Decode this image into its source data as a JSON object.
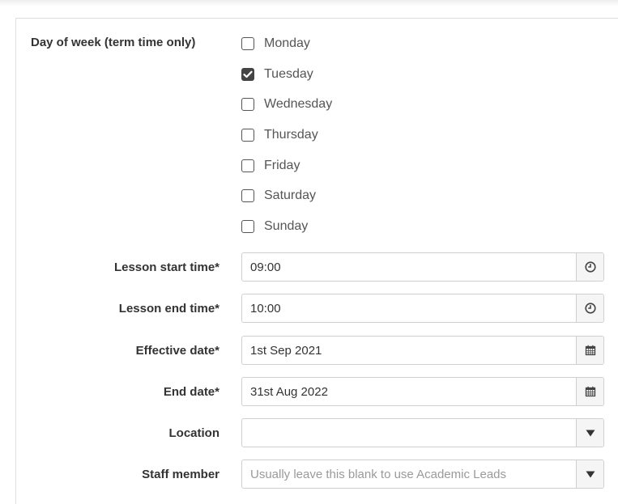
{
  "form": {
    "day_of_week": {
      "label": "Day of week (term time only)",
      "options": [
        {
          "label": "Monday",
          "checked": false
        },
        {
          "label": "Tuesday",
          "checked": true
        },
        {
          "label": "Wednesday",
          "checked": false
        },
        {
          "label": "Thursday",
          "checked": false
        },
        {
          "label": "Friday",
          "checked": false
        },
        {
          "label": "Saturday",
          "checked": false
        },
        {
          "label": "Sunday",
          "checked": false
        }
      ]
    },
    "lesson_start_time": {
      "label": "Lesson start time*",
      "value": "09:00",
      "icon": "clock-icon"
    },
    "lesson_end_time": {
      "label": "Lesson end time*",
      "value": "10:00",
      "icon": "clock-icon"
    },
    "effective_date": {
      "label": "Effective date*",
      "value": "1st Sep 2021",
      "icon": "calendar-icon"
    },
    "end_date": {
      "label": "End date*",
      "value": "31st Aug 2022",
      "icon": "calendar-icon"
    },
    "location": {
      "label": "Location",
      "value": "",
      "icon": "caret-down-icon"
    },
    "staff_member": {
      "label": "Staff member",
      "value": "",
      "placeholder": "Usually leave this blank to use Academic Leads",
      "icon": "caret-down-icon"
    }
  },
  "colors": {
    "checkbox_checked": "#444444",
    "border": "#cfcfcf",
    "addon_bg": "#f5f5f5"
  }
}
